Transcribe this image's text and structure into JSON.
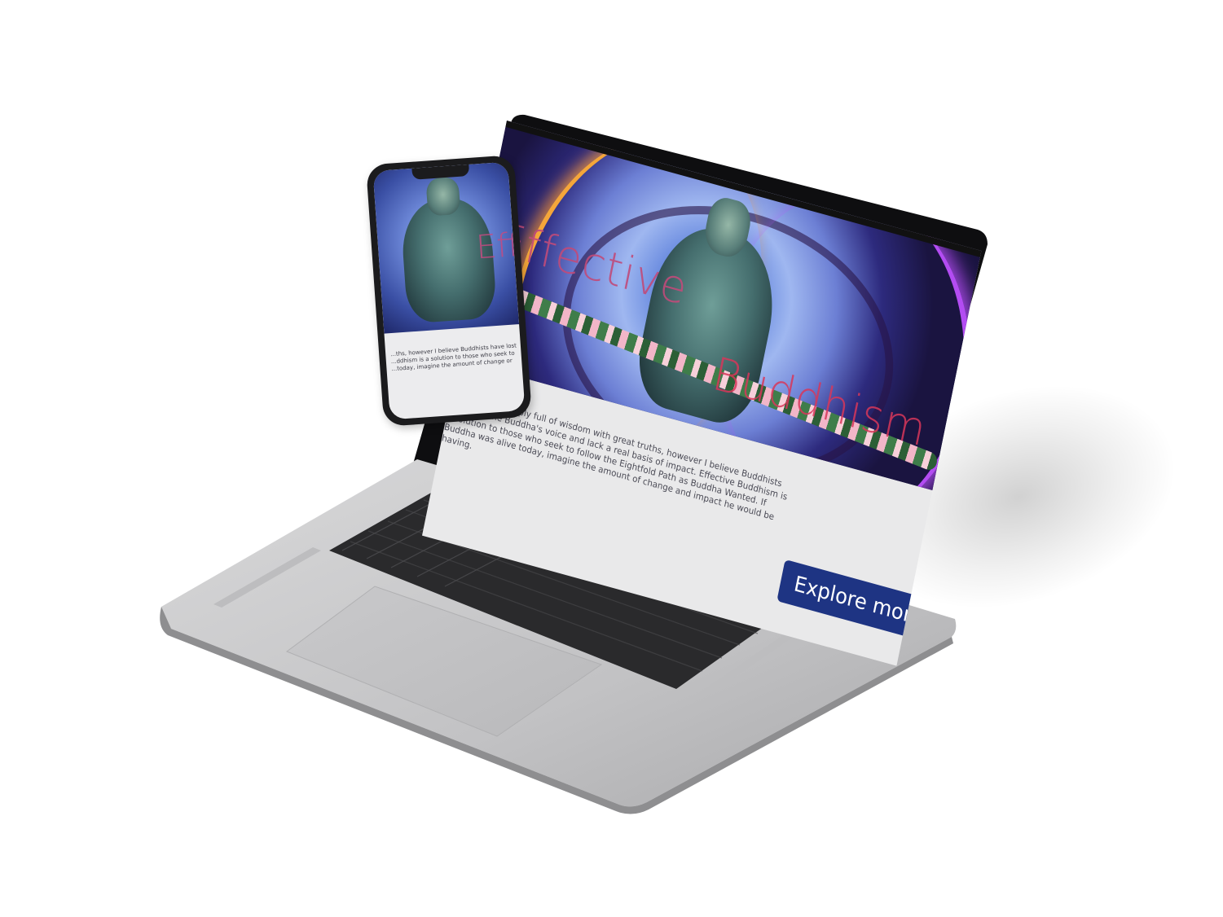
{
  "site": {
    "hero_title_line1": "Effective",
    "hero_title_line2": "Buddhism",
    "intro_text": "Buddhism is deeply full of wisdom with great truths, however I believe Buddhists have lost the Buddha's voice and lack a real basis of impact. Effective Buddhism is a solution to those who seek to follow the Eightfold Path as Buddha Wanted. If Buddha was alive today, imagine the amount of change and impact he would be having.",
    "explore_button": "Explore more"
  },
  "phone": {
    "hero_title": "Effective",
    "intro_text": "...ths, however I believe Buddhists have lost ...ddhism is a solution to those who seek to ...today, imagine the amount of change or"
  },
  "colors": {
    "button_bg": "#1e3483",
    "title_pink": "#c04b7a",
    "title_red": "#d8375a",
    "glow_purple": "#b34cf2",
    "glow_orange": "#f4a63a"
  }
}
